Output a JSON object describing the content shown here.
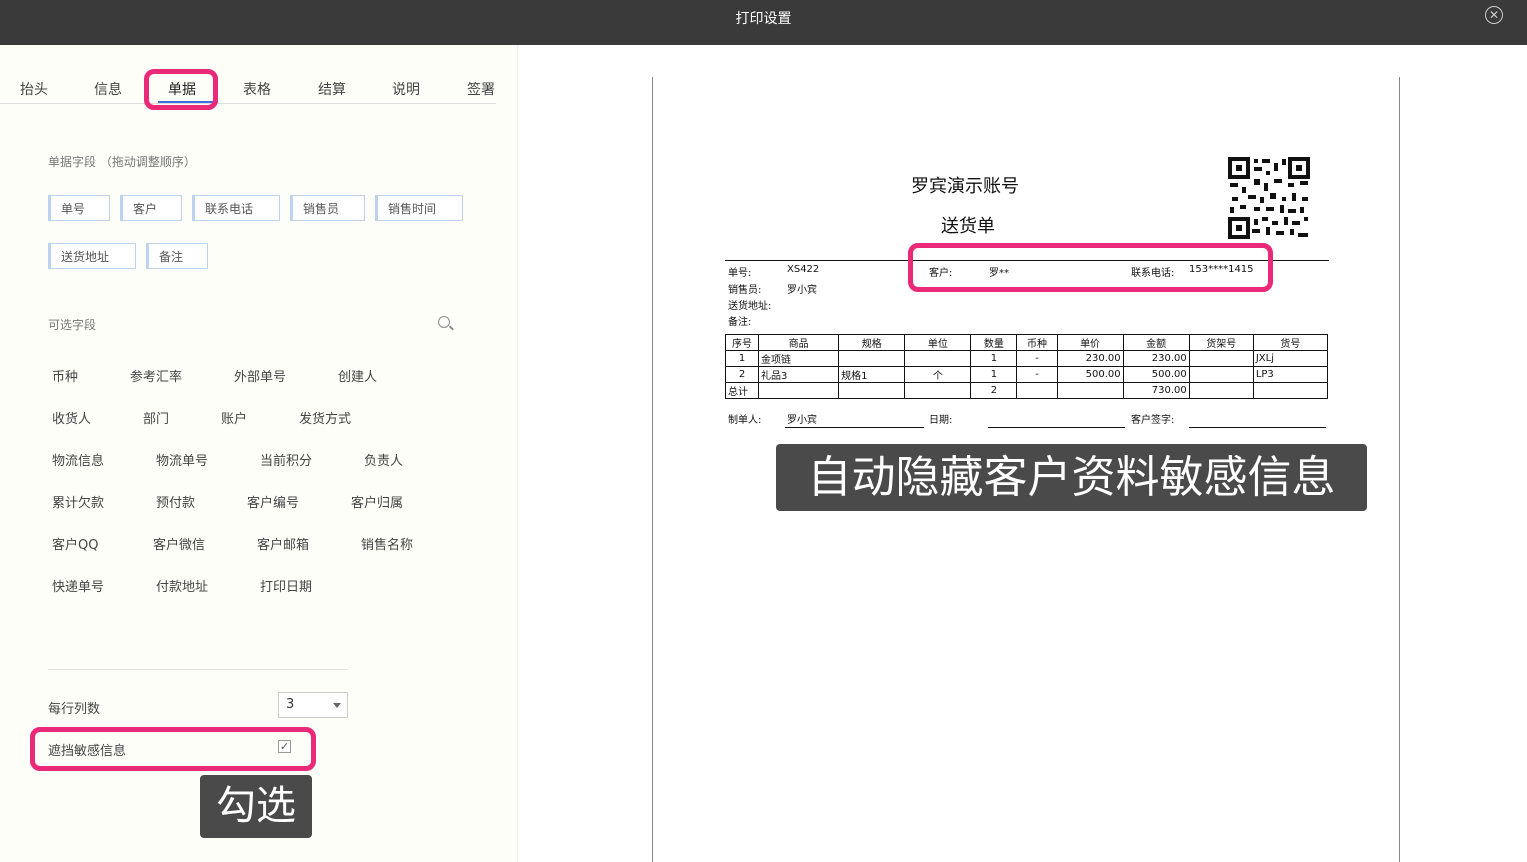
{
  "window": {
    "title": "打印设置",
    "close_glyph": "✕"
  },
  "tabs": [
    "抬头",
    "信息",
    "单据",
    "表格",
    "结算",
    "说明",
    "签署"
  ],
  "active_tab": "单据",
  "fields_section": {
    "label": "单据字段 （拖动调整顺序）",
    "fields": [
      "单号",
      "客户",
      "联系电话",
      "销售员",
      "销售时间",
      "送货地址",
      "备注"
    ]
  },
  "optional_section": {
    "label": "可选字段",
    "fields": [
      "币种",
      "参考汇率",
      "外部单号",
      "创建人",
      "收货人",
      "部门",
      "账户",
      "发货方式",
      "物流信息",
      "物流单号",
      "当前积分",
      "负责人",
      "累计欠款",
      "预付款",
      "客户编号",
      "客户归属",
      "客户QQ",
      "客户微信",
      "客户邮箱",
      "销售名称",
      "快递单号",
      "付款地址",
      "打印日期"
    ]
  },
  "settings": {
    "columns_label": "每行列数",
    "columns_value": "3",
    "mask_label": "遮挡敏感信息",
    "mask_checked": "✓"
  },
  "annotations": {
    "check_caption": "勾选",
    "hide_caption": "自动隐藏客户资料敏感信息",
    "highlight_color": "#ea2a79"
  },
  "preview": {
    "company": "罗宾演示账号",
    "doc_title": "送货单",
    "info": {
      "order_no_label": "单号:",
      "order_no": "XS422",
      "customer_label": "客户:",
      "customer": "罗**",
      "phone_label": "联系电话:",
      "phone": "153****1415",
      "sales_label": "销售员:",
      "sales": "罗小宾",
      "address_label": "送货地址:",
      "note_label": "备注:"
    },
    "table": {
      "headers": [
        "序号",
        "商品",
        "规格",
        "单位",
        "数量",
        "币种",
        "单价",
        "金额",
        "货架号",
        "货号"
      ],
      "rows": [
        [
          "1",
          "金项链",
          "",
          "",
          "1",
          "-",
          "230.00",
          "230.00",
          "",
          "JXLj"
        ],
        [
          "2",
          "礼品3",
          "规格1",
          "个",
          "1",
          "-",
          "500.00",
          "500.00",
          "",
          "LP3"
        ]
      ],
      "total": [
        "总计",
        "",
        "",
        "",
        "2",
        "",
        "",
        "730.00",
        "",
        ""
      ]
    },
    "footer": {
      "maker_label": "制单人:",
      "maker": "罗小宾",
      "date_label": "日期:",
      "sign_label": "客户签字:"
    }
  }
}
